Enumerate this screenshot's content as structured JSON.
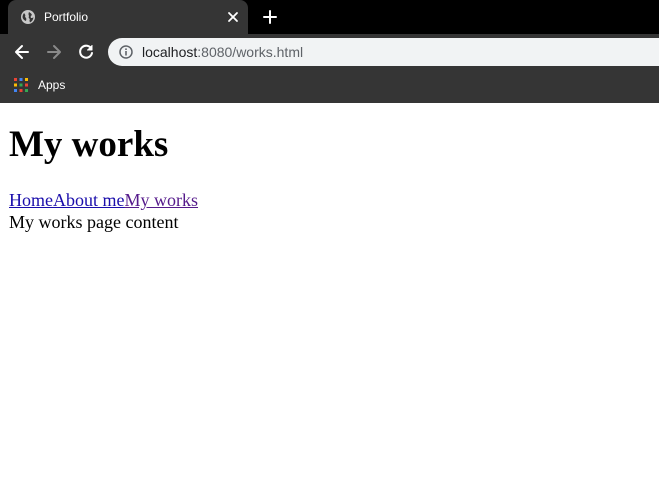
{
  "browser": {
    "tab": {
      "title": "Portfolio",
      "favicon": "globe-icon"
    },
    "address_bar": {
      "host": "localhost",
      "rest": ":8080/works.html"
    },
    "bookmarks": {
      "apps_label": "Apps"
    }
  },
  "page": {
    "heading": "My works",
    "nav": [
      {
        "label": "Home"
      },
      {
        "label": "About me"
      },
      {
        "label": "My works"
      }
    ],
    "content": "My works page content"
  },
  "colors": {
    "link": "#1a0dab",
    "visited_link": "#551a8b",
    "chrome_dark": "#353535"
  }
}
